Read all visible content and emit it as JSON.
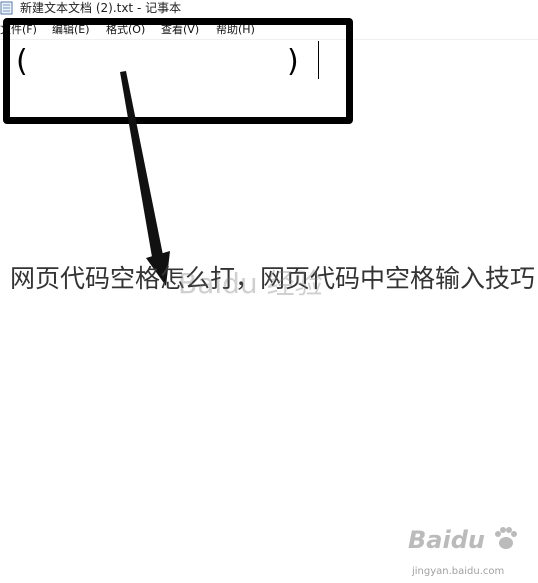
{
  "window": {
    "title": "新建文本文档 (2).txt - 记事本"
  },
  "menu": [
    {
      "label": "文件(F)"
    },
    {
      "label": "编辑(E)"
    },
    {
      "label": "格式(O)"
    },
    {
      "label": "查看(V)"
    },
    {
      "label": "帮助(H)"
    }
  ],
  "editor": {
    "open_paren": "(",
    "close_paren": ")"
  },
  "caption": "网页代码空格怎么打，网页代码中空格输入技巧",
  "watermarks": {
    "center": "Baidu 经验",
    "brand": "Baidu",
    "site_url": "jingyan.baidu.com"
  }
}
